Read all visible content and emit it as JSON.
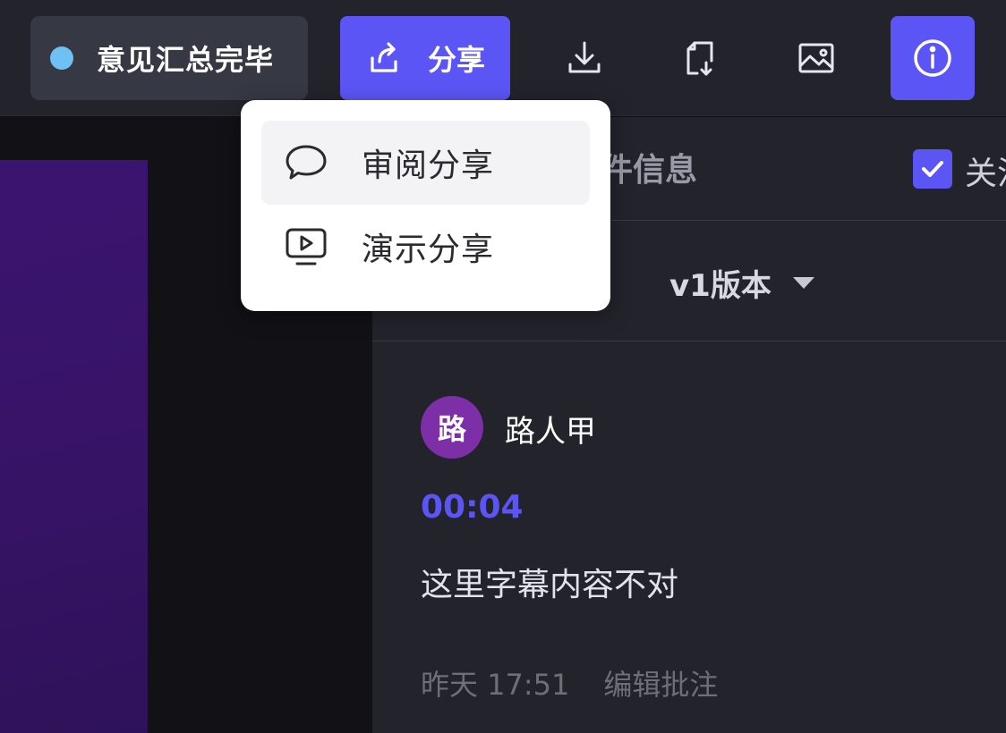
{
  "colors": {
    "accent": "#5b55f5",
    "status_dot": "#6ec1f2",
    "avatar": "#7d2fa8",
    "timecode": "#5b55f5",
    "checkbox": "#5b55f5"
  },
  "status": {
    "label": "意见汇总完毕"
  },
  "toolbar": {
    "share_label": "分享",
    "icons": [
      "share-icon",
      "download-icon",
      "file-download-icon",
      "image-icon",
      "info-icon"
    ]
  },
  "share_menu": {
    "items": [
      {
        "label": "审阅分享",
        "icon": "comment-bubble-icon",
        "active": true
      },
      {
        "label": "演示分享",
        "icon": "presentation-play-icon",
        "active": false
      }
    ]
  },
  "panel": {
    "tab_partial": "件信息",
    "checkbox_checked": true,
    "checkbox_label_partial": "关注"
  },
  "version": {
    "selected": "v1版本"
  },
  "comment": {
    "avatar_text": "路",
    "author": "路人甲",
    "timecode": "00:04",
    "text": "这里字幕内容不对",
    "time": "昨天 17:51",
    "edit_label": "编辑批注"
  }
}
